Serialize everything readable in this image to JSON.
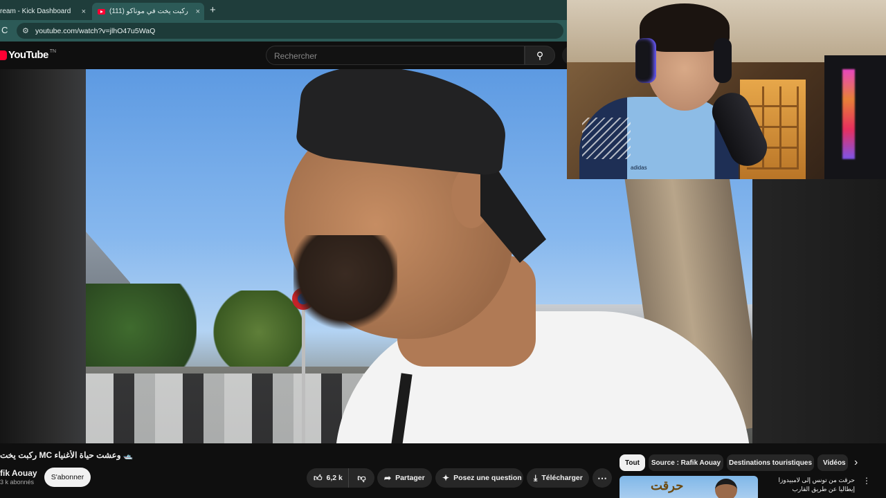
{
  "browser": {
    "tabs": [
      {
        "label": "ream - Kick Dashboard"
      },
      {
        "label": "(111) ركبت يخت في موناكو"
      }
    ],
    "tab_close_glyph": "×",
    "new_tab_glyph": "+",
    "reload_glyph": "C",
    "url": "youtube.com/watch?v=jlhO47u5WaQ"
  },
  "youtube": {
    "logo_text": "YouTube",
    "logo_sup": "TN",
    "search_placeholder": "Rechercher"
  },
  "video": {
    "title": "ركبت يخت MC وعشت حياة الأغنياء 🛥️",
    "channel": "fik Aouay",
    "subscribers": "3 k abonnés",
    "subscribe_label": "S'abonner",
    "likes": "6,2 k",
    "share_label": "Partager",
    "ask_label": "Posez une question",
    "download_label": "Télécharger"
  },
  "webcam": {
    "shirt_logo": "adidas"
  },
  "chips": [
    "Tout",
    "Source : Rafik Aouay",
    "Destinations touristiques",
    "Vidéos"
  ],
  "recommendation": {
    "thumb_text": "حرقت",
    "title": "حرقت من تونس إلى لامبيدوزا إيطاليا عن طريق القارب"
  },
  "icons": {
    "search": "search-icon",
    "like": "thumbs-up-icon",
    "dislike": "thumbs-down-icon",
    "share": "share-arrow-icon",
    "ask": "sparkle-icon",
    "download": "download-icon",
    "more": "more-horizontal-icon",
    "chevron": "chevron-right-icon"
  },
  "colors": {
    "brand_red": "#ff0033",
    "browser_frame": "#1f3d3b",
    "page_bg": "#0f0f0f"
  }
}
